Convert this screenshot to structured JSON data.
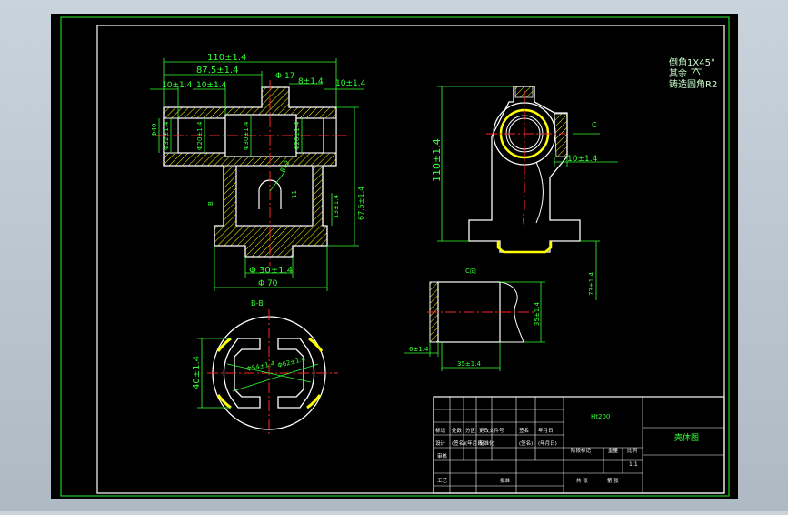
{
  "colors": {
    "background": "#000000",
    "frame": "#22cc22",
    "line": "#ffffff",
    "dimension": "#33ff33",
    "centerline": "#ff2222",
    "hatch": "#ffff00",
    "note": "#ccffcc"
  },
  "notes": {
    "chamfer": "倒角1X45°",
    "rest": "其余",
    "fillet": "铸造圆角R2"
  },
  "front_view": {
    "dims": {
      "overall": "110±1.4",
      "d875": "87.5±1.4",
      "d10a": "10±1.4",
      "d10b": "10±1.4",
      "phi17": "Φ 17",
      "d8": "8±1.4",
      "d10c": "10±1.4",
      "phi40": "Φ40",
      "phi32": "Φ32±1.4",
      "phi20a": "Φ20±1.4",
      "phi30": "Φ30±1.4",
      "phi20b": "Φ20±1.4",
      "r12": "R12",
      "d11": "11",
      "d13": "13±1.4",
      "d675": "67.5±1.4",
      "phi30b": "Φ 30±1.4",
      "phi70": "Φ 70",
      "bmark": "B"
    }
  },
  "side_view": {
    "dims": {
      "height": "110±1.4",
      "d10": "10±1.4",
      "c_mark": "C",
      "d73": "73±1.4"
    }
  },
  "section_bb": {
    "label": "B-B",
    "dims": {
      "d40": "40±1.4",
      "phi54": "Φ54±1.4",
      "phi62": "Φ62±1.4"
    }
  },
  "view_c": {
    "label": "C向",
    "dims": {
      "d35v": "35±1.4",
      "d6": "6±1.4",
      "d35h": "35±1.4"
    }
  },
  "title_block": {
    "material": "Ht200",
    "drawing_name": "壳体图",
    "row1": [
      "标记",
      "处数",
      "分区",
      "更改文件号",
      "签名",
      "年月日"
    ],
    "row2": [
      "设计",
      "(签名)",
      "(年月日)",
      "标准化",
      "(签名)",
      "(年月日)"
    ],
    "stage_label": "阶段标记",
    "weight_label": "重量",
    "scale_label": "比例",
    "scale_value": "1:1",
    "audit": "审核",
    "process": "工艺",
    "approve": "批准",
    "sheet_total": "共 张",
    "sheet_no": "第 张"
  }
}
